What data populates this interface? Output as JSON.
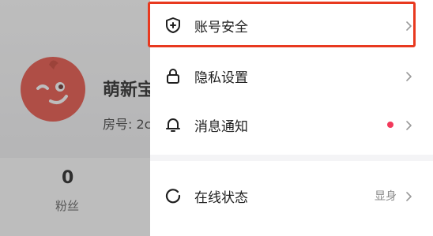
{
  "profile": {
    "name": "萌新宝",
    "room_no": "房号: 2c",
    "fans_count": "0",
    "fans_label": "粉丝"
  },
  "drawer": {
    "items": [
      {
        "label": "账号安全",
        "icon": "shield-plus-icon"
      },
      {
        "label": "隐私设置",
        "icon": "lock-icon"
      },
      {
        "label": "消息通知",
        "icon": "bell-icon",
        "has_red_dot": true
      },
      {
        "label": "在线状态",
        "icon": "status-ring-icon",
        "value": "显身"
      }
    ]
  },
  "colors": {
    "highlight": "#e8391f",
    "red_dot": "#f2395b",
    "avatar": "#e8473a"
  }
}
